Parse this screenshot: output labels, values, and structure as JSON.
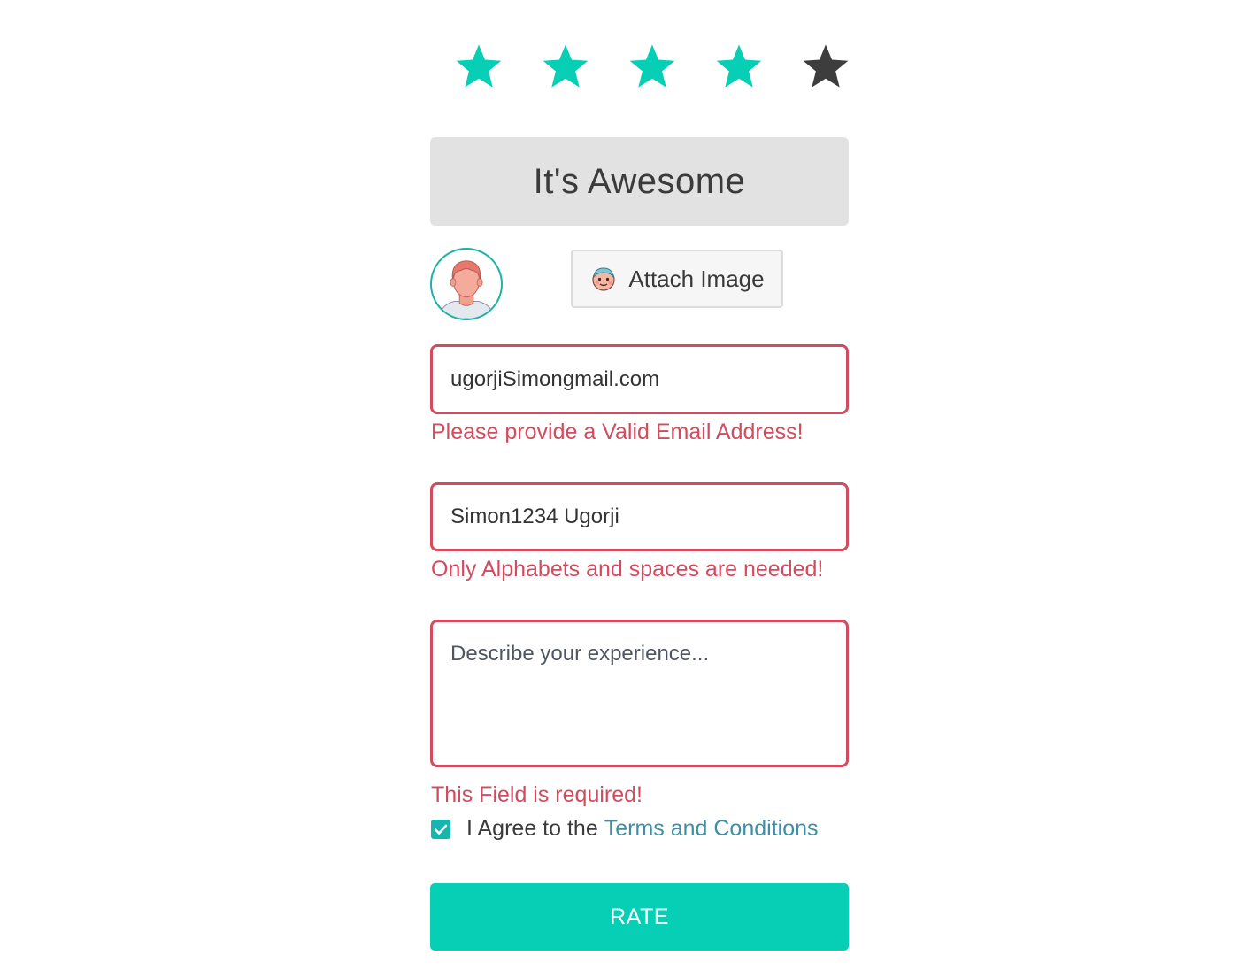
{
  "rating": {
    "value": 4,
    "max": 5,
    "label": "It's Awesome",
    "active_color": "#06cfb6",
    "inactive_color": "#3d3d3d"
  },
  "avatar": {
    "icon": "user-avatar-icon"
  },
  "attach": {
    "label": "Attach Image",
    "icon": "face-emoji-icon"
  },
  "form": {
    "email": {
      "value": "ugorjiSimongmail.com",
      "error": "Please provide a Valid Email Address!"
    },
    "name": {
      "value": "Simon1234 Ugorji",
      "error": "Only Alphabets and spaces are needed!"
    },
    "description": {
      "value": "",
      "placeholder": "Describe your experience...",
      "error": "This Field is required!"
    },
    "agree": {
      "checked": true,
      "text": "I Agree to the",
      "link_text": "Terms and Conditions"
    },
    "submit_label": "RATE"
  },
  "colors": {
    "accent": "#06cfb6",
    "error": "#d34b5e",
    "link": "#3d8fa8",
    "label_bg": "#e2e2e2"
  }
}
